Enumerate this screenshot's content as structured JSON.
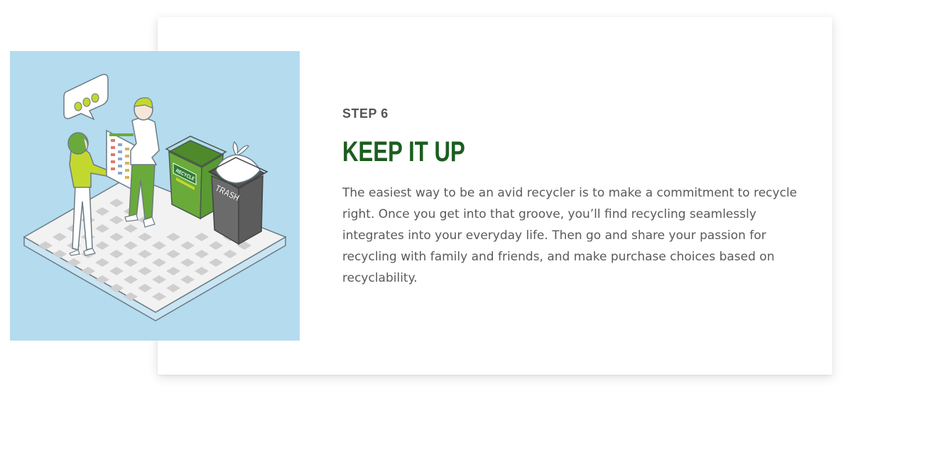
{
  "step": {
    "label": "STEP 6",
    "title": "KEEP IT UP",
    "description": "The easiest way to be an avid recycler is to make a commitment to recycle right. Once you get into that groove, you’ll find recycling seamlessly integrates into your everyday life. Then go and share your passion for recycling with family and friends, and make purchase choices based on recyclability."
  },
  "illustration": {
    "recycle_bin_label": "RECYCLE",
    "trash_bin_label": "TRASH"
  },
  "colors": {
    "heading": "#1b5e20",
    "illustration_background": "#b4dbee",
    "recycle_bin": "#6aaa3a",
    "trash_bin": "#6b6b6b",
    "accent_lime": "#c3d82e"
  }
}
